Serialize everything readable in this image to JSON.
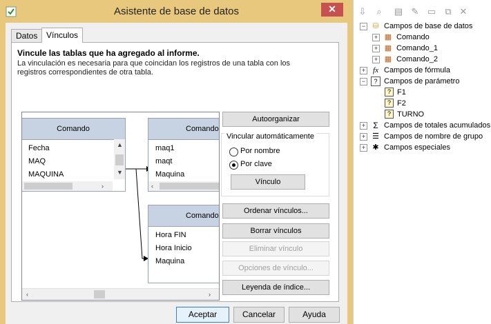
{
  "dialog": {
    "title": "Asistente de base de datos",
    "close_glyph": "✕",
    "tabs": [
      {
        "label": "Datos",
        "selected": false
      },
      {
        "label": "Vínculos",
        "selected": true
      }
    ],
    "heading": "Vincule las tablas que ha agregado al informe.",
    "description": "La vinculación es necesaria para que coincidan los registros de una tabla con los registros correspondientes de otra tabla.",
    "tables": [
      {
        "header": "Comando",
        "fields": [
          "Fecha",
          "MAQ",
          "MAQUINA"
        ]
      },
      {
        "header": "Comando",
        "fields": [
          "maq1",
          "maqt",
          "Maquina"
        ]
      },
      {
        "header": "Comando",
        "fields": [
          "Hora FIN",
          "Hora Inicio",
          "Maquina"
        ]
      }
    ],
    "buttons": {
      "autoorganizar": "Autoorganizar",
      "vincular_auto_label": "Vincular automáticamente",
      "por_nombre": "Por nombre",
      "por_clave": "Por clave",
      "selected_mode": "Por clave",
      "vinculo": "Vínculo",
      "ordenar": "Ordenar vínculos...",
      "borrar": "Borrar vínculos",
      "eliminar": "Eliminar vínculo",
      "opciones": "Opciones de vínculo...",
      "leyenda": "Leyenda de índice..."
    },
    "footer": {
      "aceptar": "Aceptar",
      "cancelar": "Cancelar",
      "ayuda": "Ayuda"
    },
    "colors": {
      "titlebar": "#e8c87c",
      "close": "#c75050",
      "table_header": "#c7d3e3"
    }
  },
  "field_explorer": {
    "toolbar_icons": [
      "insert-field-icon",
      "browse-field-icon",
      "new-icon",
      "edit-icon",
      "rename-icon",
      "duplicate-icon",
      "delete-icon"
    ],
    "tree": [
      {
        "label": "Campos de base de datos",
        "expander": "−",
        "icon": "database-icon"
      },
      {
        "label": "Comando",
        "expander": "+",
        "icon": "table-icon"
      },
      {
        "label": "Comando_1",
        "expander": "+",
        "icon": "table-icon"
      },
      {
        "label": "Comando_2",
        "expander": "+",
        "icon": "table-icon"
      },
      {
        "label": "Campos de fórmula",
        "expander": "+",
        "icon": "formula-icon"
      },
      {
        "label": "Campos de parámetro",
        "expander": "−",
        "icon": "parameter-icon"
      },
      {
        "label": "F1",
        "expander": "",
        "icon": "parameter-field-icon"
      },
      {
        "label": "F2",
        "expander": "",
        "icon": "parameter-field-icon"
      },
      {
        "label": "TURNO",
        "expander": "",
        "icon": "parameter-field-icon"
      },
      {
        "label": "Campos de totales acumulados",
        "expander": "+",
        "icon": "running-total-icon"
      },
      {
        "label": "Campos de nombre de grupo",
        "expander": "+",
        "icon": "group-name-icon"
      },
      {
        "label": "Campos especiales",
        "expander": "+",
        "icon": "special-fields-icon"
      }
    ]
  }
}
